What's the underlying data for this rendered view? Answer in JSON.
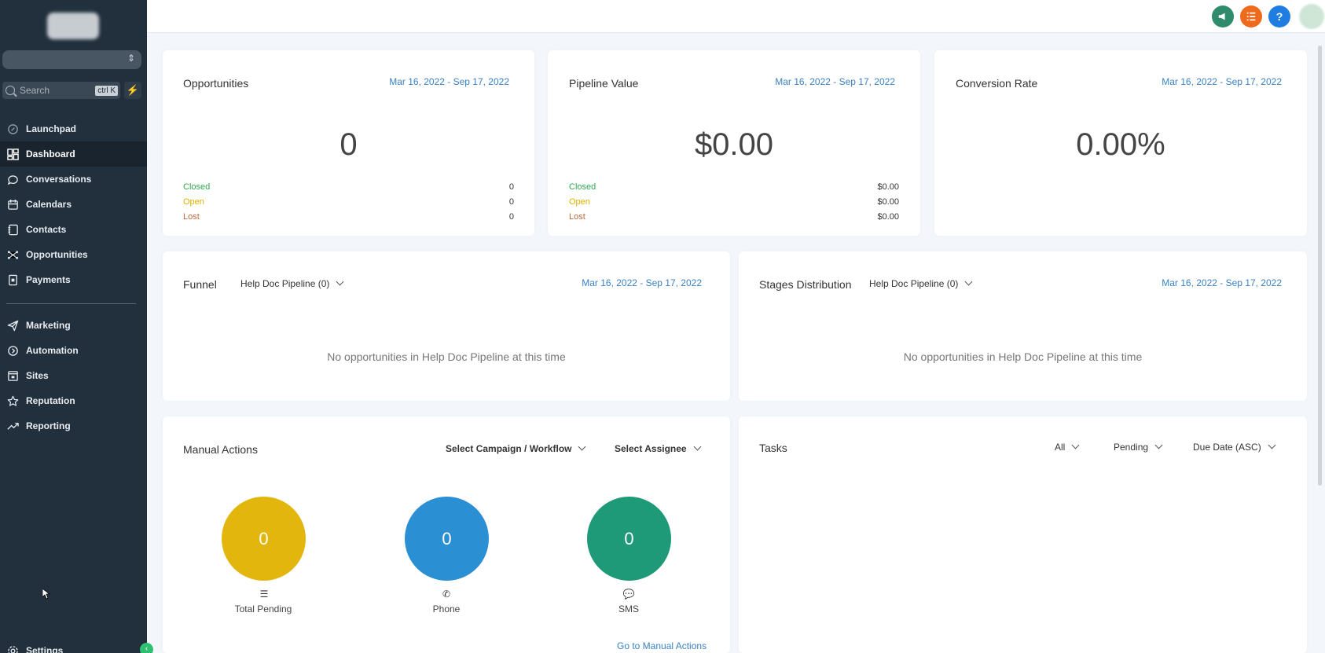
{
  "sidebar": {
    "search_placeholder": "Search",
    "search_shortcut": "ctrl K",
    "items": [
      {
        "label": "Launchpad",
        "icon": "rocket-icon"
      },
      {
        "label": "Dashboard",
        "icon": "grid-icon",
        "active": true
      },
      {
        "label": "Conversations",
        "icon": "chat-icon"
      },
      {
        "label": "Calendars",
        "icon": "calendar-icon"
      },
      {
        "label": "Contacts",
        "icon": "contacts-icon"
      },
      {
        "label": "Opportunities",
        "icon": "network-icon"
      },
      {
        "label": "Payments",
        "icon": "receipt-icon"
      }
    ],
    "items2": [
      {
        "label": "Marketing",
        "icon": "send-icon"
      },
      {
        "label": "Automation",
        "icon": "automation-icon"
      },
      {
        "label": "Sites",
        "icon": "browser-icon"
      },
      {
        "label": "Reputation",
        "icon": "star-icon"
      },
      {
        "label": "Reporting",
        "icon": "trend-icon"
      }
    ],
    "settings_label": "Settings"
  },
  "cards": {
    "opportunities": {
      "title": "Opportunities",
      "date": "Mar 16, 2022 - Sep 17, 2022",
      "value": "0",
      "closed_label": "Closed",
      "closed": "0",
      "open_label": "Open",
      "open": "0",
      "lost_label": "Lost",
      "lost": "0"
    },
    "pipeline": {
      "title": "Pipeline Value",
      "date": "Mar 16, 2022 - Sep 17, 2022",
      "value": "$0.00",
      "closed_label": "Closed",
      "closed": "$0.00",
      "open_label": "Open",
      "open": "$0.00",
      "lost_label": "Lost",
      "lost": "$0.00"
    },
    "conversion": {
      "title": "Conversion Rate",
      "date": "Mar 16, 2022 - Sep 17, 2022",
      "value": "0.00%"
    },
    "funnel": {
      "title": "Funnel",
      "pipeline": "Help Doc Pipeline (0)",
      "date": "Mar 16, 2022 - Sep 17, 2022",
      "empty": "No opportunities in Help Doc Pipeline at this time"
    },
    "stages": {
      "title": "Stages Distribution",
      "pipeline": "Help Doc Pipeline (0)",
      "date": "Mar 16, 2022 - Sep 17, 2022",
      "empty": "No opportunities in Help Doc Pipeline at this time"
    },
    "manual": {
      "title": "Manual Actions",
      "campaign": "Select Campaign / Workflow",
      "assignee": "Select Assignee",
      "total_value": "0",
      "total_label": "Total Pending",
      "phone_value": "0",
      "phone_label": "Phone",
      "sms_value": "0",
      "sms_label": "SMS",
      "link": "Go to Manual Actions",
      "colors": {
        "total": "#e3b60e",
        "phone": "#2b8fd3",
        "sms": "#1f9a79"
      }
    },
    "tasks": {
      "title": "Tasks",
      "filter_all": "All",
      "filter_status": "Pending",
      "sort": "Due Date (ASC)"
    }
  }
}
